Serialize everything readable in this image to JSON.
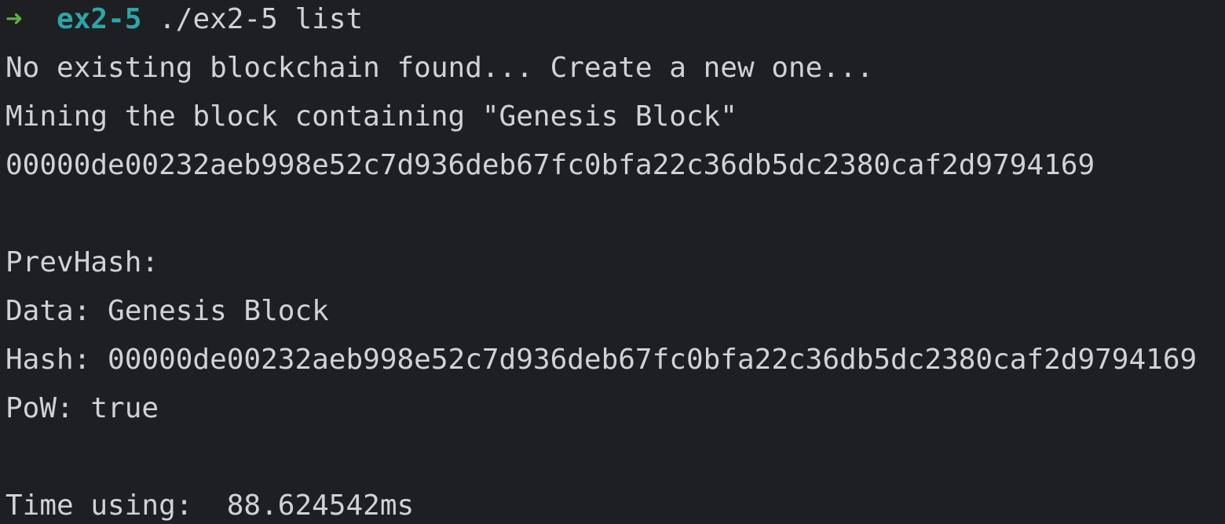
{
  "terminal": {
    "prompt": {
      "arrow": "➜",
      "directory": "ex2-5",
      "command": "./ex2-5 list"
    },
    "lines": {
      "no_chain": "No existing blockchain found... Create a new one...",
      "mining": "Mining the block containing \"Genesis Block\"",
      "mined_hash": "00000de00232aeb998e52c7d936deb67fc0bfa22c36db5dc2380caf2d9794169",
      "prev_hash": "PrevHash:",
      "data": "Data: Genesis Block",
      "hash": "Hash: 00000de00232aeb998e52c7d936deb67fc0bfa22c36db5dc2380caf2d9794169",
      "pow": "PoW: true",
      "time": "Time using:  88.624542ms"
    }
  },
  "colors": {
    "background": "#1e1f22",
    "text": "#cfd2d6",
    "prompt_arrow": "#5fb13a",
    "prompt_dir": "#2aa7a7"
  }
}
